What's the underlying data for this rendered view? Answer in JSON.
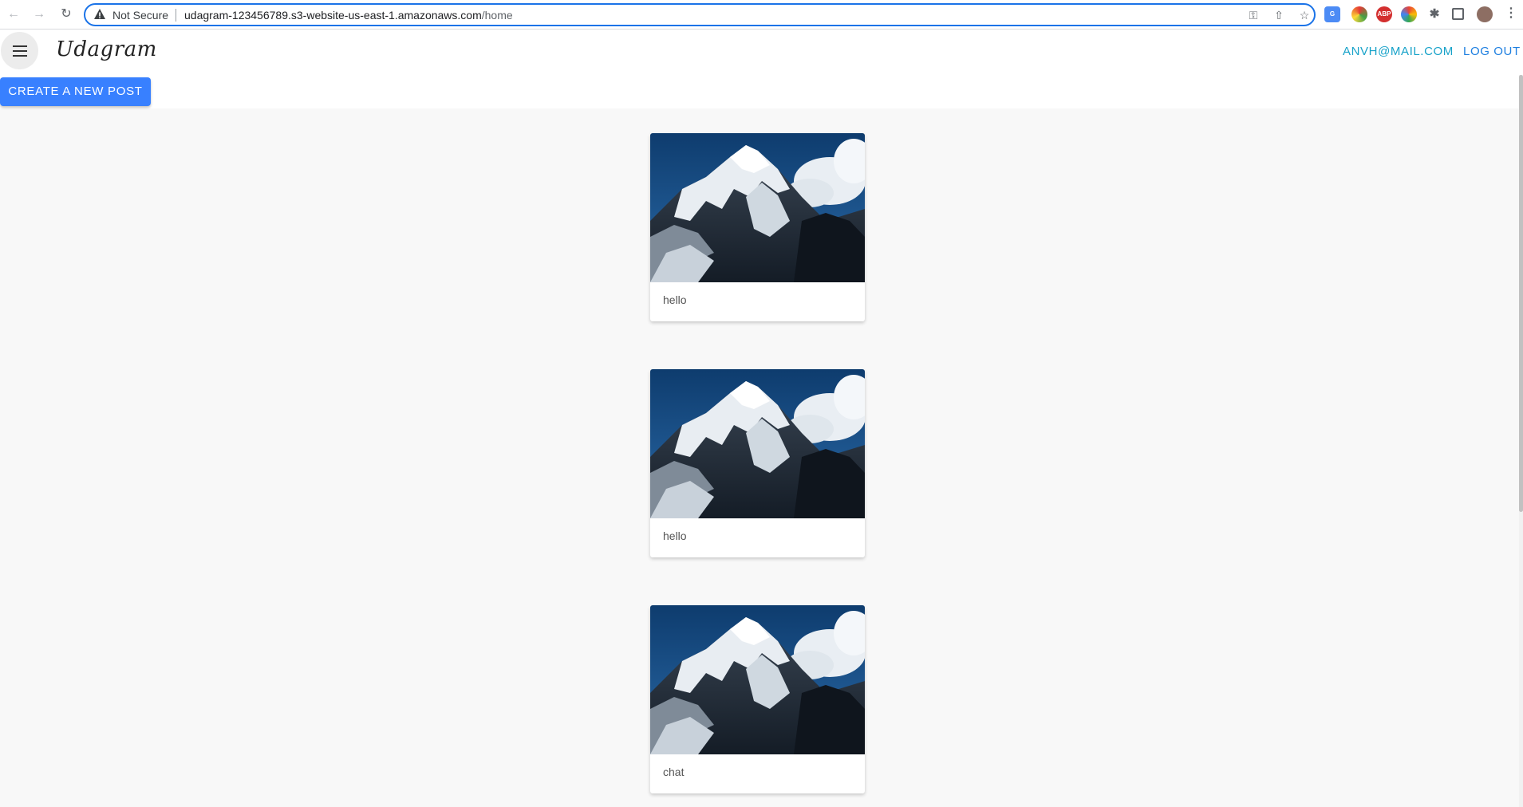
{
  "browser": {
    "security_label": "Not Secure",
    "url_host": "udagram-123456789.s3-website-us-east-1.amazonaws.com",
    "url_path": "/home",
    "extensions": [
      "translate-extension-icon",
      "color-extension-icon",
      "abp-extension-icon",
      "chrome-extension-icon",
      "puzzle-extensions-icon",
      "side-panel-icon",
      "profile-avatar"
    ],
    "abp_label": "ABP"
  },
  "app": {
    "brand": "Udagram",
    "user_email": "ANVH@MAIL.COM",
    "logout_label": "LOG OUT",
    "create_post_label": "CREATE A NEW POST",
    "accent_color": "#3880ff"
  },
  "feed": {
    "posts": [
      {
        "caption": "hello",
        "image": "mountain-photo"
      },
      {
        "caption": "hello",
        "image": "mountain-photo"
      },
      {
        "caption": "chat",
        "image": "mountain-photo"
      }
    ]
  }
}
